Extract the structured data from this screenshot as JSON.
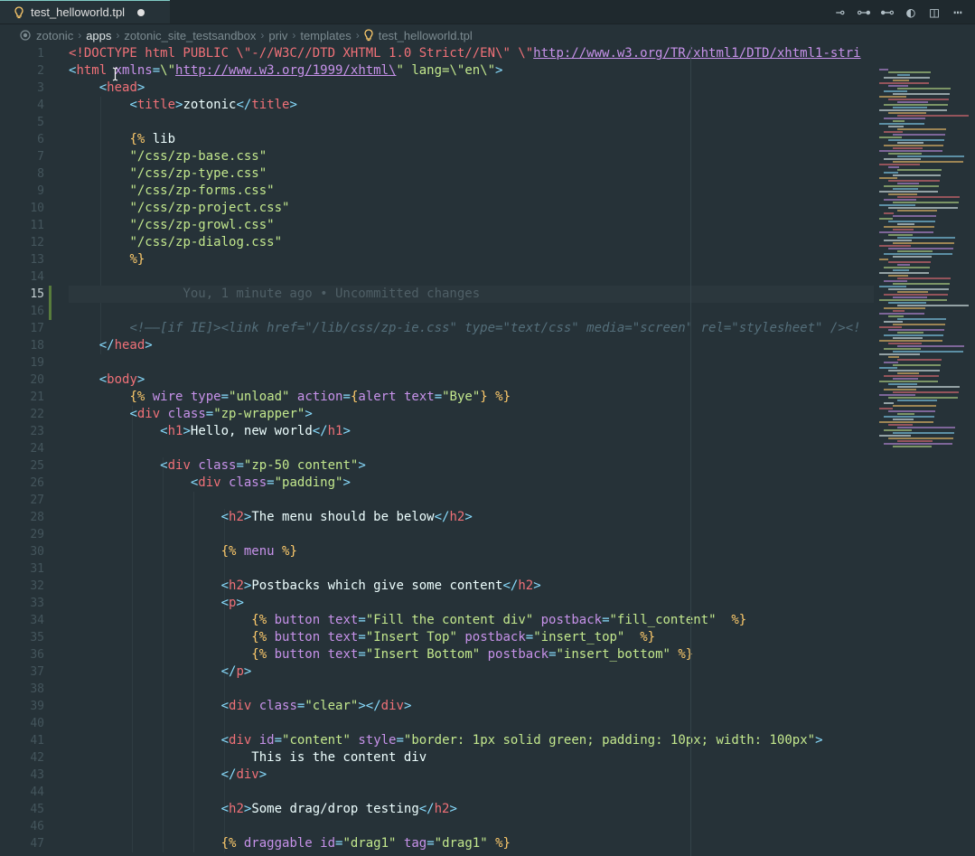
{
  "tab": {
    "filename": "test_helloworld.tpl",
    "icon": "bulb-icon",
    "modified": true
  },
  "actions": [
    {
      "name": "git-compare-icon",
      "glyph": "⊸"
    },
    {
      "name": "git-commit-icon",
      "glyph": "⊶"
    },
    {
      "name": "git-commit-next-icon",
      "glyph": "⊷"
    },
    {
      "name": "toggle-blame-icon",
      "glyph": "◐"
    },
    {
      "name": "split-editor-icon",
      "glyph": "◫"
    },
    {
      "name": "more-actions-icon",
      "glyph": "⋯"
    }
  ],
  "breadcrumb": [
    "zotonic",
    "apps",
    "zotonic_site_testsandbox",
    "priv",
    "templates",
    "test_helloworld.tpl"
  ],
  "current_line": 15,
  "blame": "You, 1 minute ago • Uncommitted changes",
  "lines": [
    [
      [
        "dt",
        "<!DOCTYPE"
      ],
      [
        "tag",
        " html PUBLIC \\\"-//W3C//DTD XHTML 1.0 Strict//EN\\\" \\\""
      ],
      [
        "url",
        "http://www.w3.org/TR/xhtml1/DTD/xhtml1-stri"
      ]
    ],
    [
      [
        "kw",
        "<"
      ],
      [
        "tag",
        "html"
      ],
      [
        "attr",
        " xmlns"
      ],
      [
        "kw",
        "="
      ],
      [
        "str",
        "\\\""
      ],
      [
        "url",
        "http://www.w3.org/1999/xhtml\\"
      ],
      [
        "str",
        "\" lang=\\\"en\\\""
      ],
      [
        "kw",
        ">"
      ]
    ],
    [
      [
        "txt",
        "    "
      ],
      [
        "kw",
        "<"
      ],
      [
        "tag",
        "head"
      ],
      [
        "kw",
        ">"
      ]
    ],
    [
      [
        "txt",
        "        "
      ],
      [
        "kw",
        "<"
      ],
      [
        "tag",
        "title"
      ],
      [
        "kw",
        ">"
      ],
      [
        "txt",
        "zotonic"
      ],
      [
        "kw",
        "</"
      ],
      [
        "tag",
        "title"
      ],
      [
        "kw",
        ">"
      ]
    ],
    [],
    [
      [
        "txt",
        "        "
      ],
      [
        "tpl",
        "{%"
      ],
      [
        "txt",
        " lib"
      ]
    ],
    [
      [
        "txt",
        "        "
      ],
      [
        "str",
        "\"/css/zp-base.css\""
      ]
    ],
    [
      [
        "txt",
        "        "
      ],
      [
        "str",
        "\"/css/zp-type.css\""
      ]
    ],
    [
      [
        "txt",
        "        "
      ],
      [
        "str",
        "\"/css/zp-forms.css\""
      ]
    ],
    [
      [
        "txt",
        "        "
      ],
      [
        "str",
        "\"/css/zp-project.css\""
      ]
    ],
    [
      [
        "txt",
        "        "
      ],
      [
        "str",
        "\"/css/zp-growl.css\""
      ]
    ],
    [
      [
        "txt",
        "        "
      ],
      [
        "str",
        "\"/css/zp-dialog.css\""
      ]
    ],
    [
      [
        "txt",
        "        "
      ],
      [
        "tpl",
        "%}"
      ]
    ],
    [],
    [],
    [],
    [
      [
        "txt",
        "        "
      ],
      [
        "comment",
        "<!——[if IE]><link href=\"/lib/css/zp-ie.css\" type=\"text/css\" media=\"screen\" rel=\"stylesheet\" /><!"
      ]
    ],
    [
      [
        "txt",
        "    "
      ],
      [
        "kw",
        "</"
      ],
      [
        "tag",
        "head"
      ],
      [
        "kw",
        ">"
      ]
    ],
    [],
    [
      [
        "txt",
        "    "
      ],
      [
        "kw",
        "<"
      ],
      [
        "tag",
        "body"
      ],
      [
        "kw",
        ">"
      ]
    ],
    [
      [
        "txt",
        "        "
      ],
      [
        "tpl",
        "{%"
      ],
      [
        "tplkw",
        " wire"
      ],
      [
        "attr",
        " type"
      ],
      [
        "kw",
        "="
      ],
      [
        "str",
        "\"unload\""
      ],
      [
        "attr",
        " action"
      ],
      [
        "kw",
        "="
      ],
      [
        "tpl",
        "{"
      ],
      [
        "tplkw",
        "alert"
      ],
      [
        "attr",
        " text"
      ],
      [
        "kw",
        "="
      ],
      [
        "str",
        "\"Bye\""
      ],
      [
        "tpl",
        "}"
      ],
      [
        "tpl",
        " %}"
      ]
    ],
    [
      [
        "txt",
        "        "
      ],
      [
        "kw",
        "<"
      ],
      [
        "tag",
        "div"
      ],
      [
        "attr",
        " class"
      ],
      [
        "kw",
        "="
      ],
      [
        "str",
        "\"zp-wrapper\""
      ],
      [
        "kw",
        ">"
      ]
    ],
    [
      [
        "txt",
        "            "
      ],
      [
        "kw",
        "<"
      ],
      [
        "tag",
        "h1"
      ],
      [
        "kw",
        ">"
      ],
      [
        "txt",
        "Hello, new world"
      ],
      [
        "kw",
        "</"
      ],
      [
        "tag",
        "h1"
      ],
      [
        "kw",
        ">"
      ]
    ],
    [],
    [
      [
        "txt",
        "            "
      ],
      [
        "kw",
        "<"
      ],
      [
        "tag",
        "div"
      ],
      [
        "attr",
        " class"
      ],
      [
        "kw",
        "="
      ],
      [
        "str",
        "\"zp-50 content\""
      ],
      [
        "kw",
        ">"
      ]
    ],
    [
      [
        "txt",
        "                "
      ],
      [
        "kw",
        "<"
      ],
      [
        "tag",
        "div"
      ],
      [
        "attr",
        " class"
      ],
      [
        "kw",
        "="
      ],
      [
        "str",
        "\"padding\""
      ],
      [
        "kw",
        ">"
      ]
    ],
    [],
    [
      [
        "txt",
        "                    "
      ],
      [
        "kw",
        "<"
      ],
      [
        "tag",
        "h2"
      ],
      [
        "kw",
        ">"
      ],
      [
        "txt",
        "The menu should be below"
      ],
      [
        "kw",
        "</"
      ],
      [
        "tag",
        "h2"
      ],
      [
        "kw",
        ">"
      ]
    ],
    [],
    [
      [
        "txt",
        "                    "
      ],
      [
        "tpl",
        "{%"
      ],
      [
        "tplkw",
        " menu"
      ],
      [
        "tpl",
        " %}"
      ]
    ],
    [],
    [
      [
        "txt",
        "                    "
      ],
      [
        "kw",
        "<"
      ],
      [
        "tag",
        "h2"
      ],
      [
        "kw",
        ">"
      ],
      [
        "txt",
        "Postbacks which give some content"
      ],
      [
        "kw",
        "</"
      ],
      [
        "tag",
        "h2"
      ],
      [
        "kw",
        ">"
      ]
    ],
    [
      [
        "txt",
        "                    "
      ],
      [
        "kw",
        "<"
      ],
      [
        "tag",
        "p"
      ],
      [
        "kw",
        ">"
      ]
    ],
    [
      [
        "txt",
        "                        "
      ],
      [
        "tpl",
        "{%"
      ],
      [
        "tplkw",
        " button"
      ],
      [
        "attr",
        " text"
      ],
      [
        "kw",
        "="
      ],
      [
        "str",
        "\"Fill the content div\""
      ],
      [
        "attr",
        " postback"
      ],
      [
        "kw",
        "="
      ],
      [
        "str",
        "\"fill_content\""
      ],
      [
        "tpl",
        "  %}"
      ]
    ],
    [
      [
        "txt",
        "                        "
      ],
      [
        "tpl",
        "{%"
      ],
      [
        "tplkw",
        " button"
      ],
      [
        "attr",
        " text"
      ],
      [
        "kw",
        "="
      ],
      [
        "str",
        "\"Insert Top\""
      ],
      [
        "attr",
        " postback"
      ],
      [
        "kw",
        "="
      ],
      [
        "str",
        "\"insert_top\""
      ],
      [
        "tpl",
        "  %}"
      ]
    ],
    [
      [
        "txt",
        "                        "
      ],
      [
        "tpl",
        "{%"
      ],
      [
        "tplkw",
        " button"
      ],
      [
        "attr",
        " text"
      ],
      [
        "kw",
        "="
      ],
      [
        "str",
        "\"Insert Bottom\""
      ],
      [
        "attr",
        " postback"
      ],
      [
        "kw",
        "="
      ],
      [
        "str",
        "\"insert_bottom\""
      ],
      [
        "tpl",
        " %}"
      ]
    ],
    [
      [
        "txt",
        "                    "
      ],
      [
        "kw",
        "</"
      ],
      [
        "tag",
        "p"
      ],
      [
        "kw",
        ">"
      ]
    ],
    [],
    [
      [
        "txt",
        "                    "
      ],
      [
        "kw",
        "<"
      ],
      [
        "tag",
        "div"
      ],
      [
        "attr",
        " class"
      ],
      [
        "kw",
        "="
      ],
      [
        "str",
        "\"clear\""
      ],
      [
        "kw",
        "></"
      ],
      [
        "tag",
        "div"
      ],
      [
        "kw",
        ">"
      ]
    ],
    [],
    [
      [
        "txt",
        "                    "
      ],
      [
        "kw",
        "<"
      ],
      [
        "tag",
        "div"
      ],
      [
        "attr",
        " id"
      ],
      [
        "kw",
        "="
      ],
      [
        "str",
        "\"content\""
      ],
      [
        "attr",
        " style"
      ],
      [
        "kw",
        "="
      ],
      [
        "str",
        "\"border: 1px solid green; padding: 10px; width: 100px\""
      ],
      [
        "kw",
        ">"
      ]
    ],
    [
      [
        "txt",
        "                        This is the content div"
      ]
    ],
    [
      [
        "txt",
        "                    "
      ],
      [
        "kw",
        "</"
      ],
      [
        "tag",
        "div"
      ],
      [
        "kw",
        ">"
      ]
    ],
    [],
    [
      [
        "txt",
        "                    "
      ],
      [
        "kw",
        "<"
      ],
      [
        "tag",
        "h2"
      ],
      [
        "kw",
        ">"
      ],
      [
        "txt",
        "Some drag/drop testing"
      ],
      [
        "kw",
        "</"
      ],
      [
        "tag",
        "h2"
      ],
      [
        "kw",
        ">"
      ]
    ],
    [],
    [
      [
        "txt",
        "                    "
      ],
      [
        "tpl",
        "{%"
      ],
      [
        "tplkw",
        " draggable"
      ],
      [
        "attr",
        " id"
      ],
      [
        "kw",
        "="
      ],
      [
        "str",
        "\"drag1\""
      ],
      [
        "attr",
        " tag"
      ],
      [
        "kw",
        "="
      ],
      [
        "str",
        "\"drag1\""
      ],
      [
        "tpl",
        " %}"
      ]
    ]
  ]
}
